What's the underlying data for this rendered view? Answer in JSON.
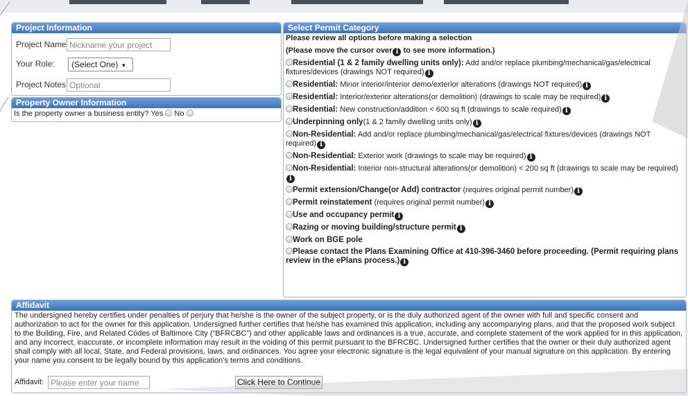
{
  "project": {
    "header": "Project Information",
    "name_label": "Project Name:",
    "name_placeholder": "Nickname your project",
    "role_label": "Your Role:",
    "role_value": "(Select One)",
    "notes_label": "Project Notes:",
    "notes_placeholder": "Optional"
  },
  "owner": {
    "header": "Property Owner Information",
    "question": "Is the property owner a business entity?",
    "yes": "Yes",
    "no": "No"
  },
  "permit": {
    "header": "Select Permit Category",
    "note1": "Please review all options before making a selection",
    "note2a": "(Please move the cursor over",
    "note2b": "to see more information.)",
    "options": [
      {
        "bold": "Residential (1 & 2 family dwelling units only):",
        "text": " Add and/or replace plumbing/mechanical/gas/electrical fixtures/devices (drawings NOT required)"
      },
      {
        "bold": "Residential:",
        "text": " Minor interior/interior demo/exterior alterations (drawings NOT required)"
      },
      {
        "bold": "Residential:",
        "text": " Interior/exterior alterations(or demolition) (drawings to scale may be required)"
      },
      {
        "bold": "Residential:",
        "text": " New construction/addition < 600 sq ft (drawings to scale required)"
      },
      {
        "bold": "Underpinning only",
        "text": "(1 & 2 family dwelling units only)"
      },
      {
        "bold": "Non-Residential:",
        "text": " Add and/or replace plumbing/mechanical/gas/electrical fixtures/devices (drawings NOT required)"
      },
      {
        "bold": "Non-Residential:",
        "text": " Exterior work (drawings to scale may be required)"
      },
      {
        "bold": "Non-Residential:",
        "text": " Interior non-structural alterations(or demolition) < 200 sq ft (drawings to scale may be required)"
      },
      {
        "bold": "Permit extension/Change(or Add) contractor",
        "text": " (requires original permit number)"
      },
      {
        "bold": "Permit reinstatement",
        "text": " (requires original permit number)"
      },
      {
        "bold": "Use and occupancy permit",
        "text": ""
      },
      {
        "bold": "Razing or moving building/structure permit",
        "text": ""
      },
      {
        "bold": "Work on BGE pole",
        "text": ""
      },
      {
        "bold": "Please contact the Plans Examining Office at 410-396-3460 before proceeding. (Permit requiring plans review in the ePlans process.)",
        "text": ""
      }
    ]
  },
  "affidavit": {
    "header": "Affidavit",
    "text": "The undersigned hereby certifies under penalties of perjury that he/she is the owner of the subject property, or is the duly authorized agent of the owner with full and specific consent and authorization to act for the owner for this application. Undersigned further certifies that he/she has examined this application, including any accompanying plans, and that the proposed work subject to the Building, Fire, and Related Codes of Baltimore City (“BFRCBC”) and other applicable laws and ordinances is a true, accurate, and complete statement of the work applied for in this application, and any incorrect, inaccurate, or incomplete information may result in the voiding of this permit pursuant to the BFRCBC. Undersigned further certifies that the owner or their duly authorized agent shall comply with all local, State, and Federal provisions, laws, and ordinances. You agree your electronic signature is the legal equivalent of your manual signature on this application. By entering your name you consent to be legally bound by this application’s terms and conditions.",
    "label": "Affidavit:",
    "placeholder": "Please enter your name",
    "button": "Click Here to Continue"
  },
  "icons": {
    "info": "info-icon",
    "radio": "radio-button"
  },
  "colors": {
    "header_top": "#6c9cd4",
    "header_bottom": "#3f74b8",
    "border": "#9bb4d4"
  }
}
